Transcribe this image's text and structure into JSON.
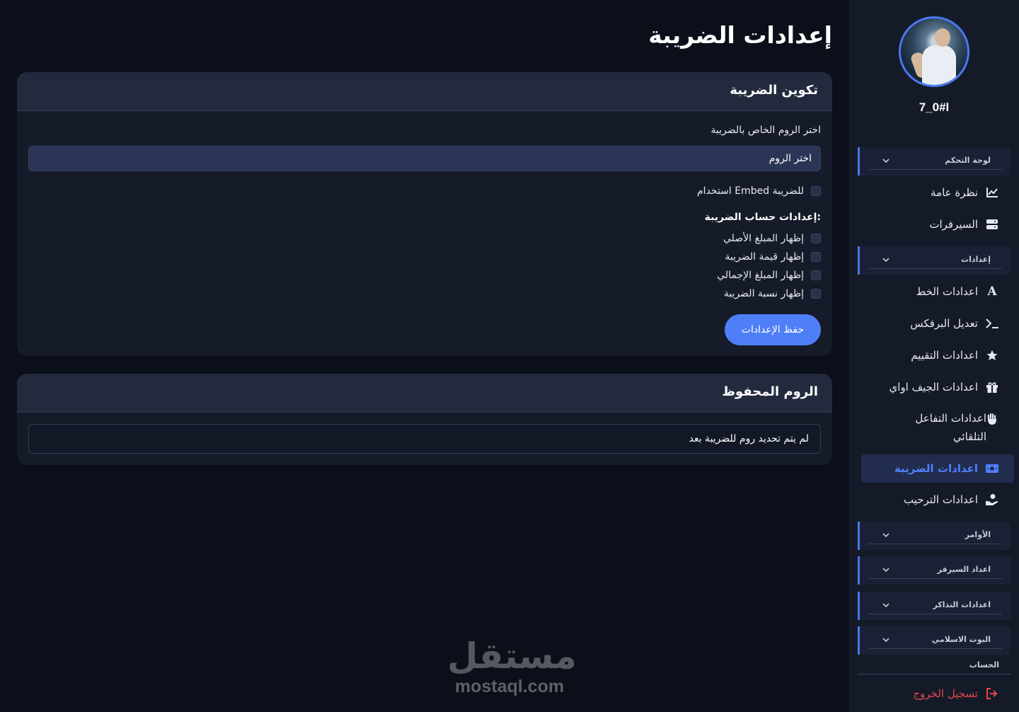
{
  "page": {
    "title": "إعدادات الضريبة"
  },
  "user": {
    "name": "7_0#l"
  },
  "sidebar": {
    "sections": {
      "dashboard": "لوحة التحكم",
      "settings": "إعدادات",
      "commands": "الأوامر",
      "server_setup": "اعداد السيرفر",
      "tickets": "اعدادات التذاكر",
      "islamic_bot": "البوت الاسلامي",
      "account": "الحساب"
    },
    "items": {
      "overview": "نظرة عامة",
      "servers": "السيرفرات",
      "font": "اعدادات الخط",
      "prefix": "تعديل البرفكس",
      "rating": "اعدادات التقييم",
      "giveaway": "اعدادات الجيف اواي",
      "auto_react": "اعدادات التفاعل التلقائي",
      "tax": "اعدادات الضريبة",
      "welcome": "اعدادات الترحيب",
      "logout": "تسجيل الخروج"
    }
  },
  "tax_config": {
    "title": "تكوين الضريبة",
    "room_label": "اختر الروم الخاص بالضريبة",
    "room_select_value": "اختر الروم",
    "embed_label": "استخدام Embed للضريبة",
    "embed_checked": false,
    "calc_heading": "إعدادات حساب الضريبة:",
    "options": [
      {
        "label": "إظهار المبلغ الأصلي",
        "checked": false
      },
      {
        "label": "إظهار قيمة الضريبة",
        "checked": false
      },
      {
        "label": "إظهار المبلغ الإجمالي",
        "checked": false
      },
      {
        "label": "إظهار نسبة الضريبة",
        "checked": false
      }
    ],
    "save_label": "حفظ الإعدادات"
  },
  "saved_room": {
    "title": "الروم المحفوظ",
    "empty_text": "لم يتم تحديد روم للضريبة بعد"
  },
  "watermark": {
    "arabic": "مستقل",
    "latin": "mostaql.com"
  },
  "colors": {
    "accent": "#4f7ff7",
    "danger": "#e5484d",
    "background": "#0b0f19"
  }
}
